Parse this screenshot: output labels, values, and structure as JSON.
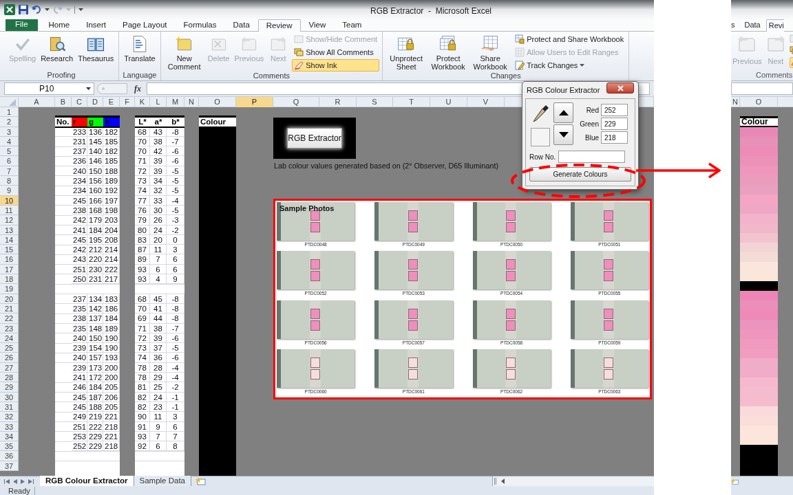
{
  "left_window": {
    "title": "RGB Extractor  -  Microsoft Excel",
    "tabs": [
      {
        "label": "File",
        "selected": false,
        "kind": "file"
      },
      {
        "label": "Home",
        "selected": false,
        "kind": "tab"
      },
      {
        "label": "Insert",
        "selected": false,
        "kind": "tab"
      },
      {
        "label": "Page Layout",
        "selected": false,
        "kind": "tab"
      },
      {
        "label": "Formulas",
        "selected": false,
        "kind": "tab"
      },
      {
        "label": "Data",
        "selected": false,
        "kind": "tab"
      },
      {
        "label": "Review",
        "selected": true,
        "kind": "tab"
      },
      {
        "label": "View",
        "selected": false,
        "kind": "tab"
      },
      {
        "label": "Team",
        "selected": false,
        "kind": "tab"
      }
    ],
    "ribbon_groups": [
      {
        "label": "Proofing",
        "buttons": [
          {
            "label": "Spelling",
            "disabled": true
          },
          {
            "label": "Research",
            "disabled": false
          },
          {
            "label": "Thesaurus",
            "disabled": false
          }
        ]
      },
      {
        "label": "Language",
        "buttons": [
          {
            "label": "Translate",
            "disabled": false
          }
        ]
      },
      {
        "label": "Comments",
        "buttons": [
          {
            "label": "New Comment",
            "disabled": false
          },
          {
            "label": "Delete",
            "disabled": true
          },
          {
            "label": "Previous",
            "disabled": true
          },
          {
            "label": "Next",
            "disabled": true
          }
        ],
        "small_buttons": [
          {
            "label": "Show/Hide Comment",
            "disabled": true,
            "on": false,
            "kind": "button"
          },
          {
            "label": "Show All Comments",
            "disabled": false,
            "on": false,
            "kind": "button"
          },
          {
            "label": "Show Ink",
            "disabled": false,
            "on": true,
            "kind": "button"
          }
        ]
      },
      {
        "label": "Changes",
        "buttons": [
          {
            "label": "Unprotect Sheet",
            "disabled": false
          },
          {
            "label": "Protect Workbook",
            "disabled": false
          },
          {
            "label": "Share Workbook",
            "disabled": false
          }
        ],
        "small_buttons": [
          {
            "label": "Protect and Share Workbook",
            "disabled": false,
            "on": false,
            "kind": "button"
          },
          {
            "label": "Allow Users to Edit Ranges",
            "disabled": true,
            "on": false,
            "kind": "button"
          },
          {
            "label": "Track Changes",
            "disabled": false,
            "on": false,
            "kind": "dropdown"
          }
        ]
      }
    ],
    "name_box": "P10",
    "function_label": "fx",
    "column_headers": [
      {
        "label": "A",
        "selected": false
      },
      {
        "label": "B",
        "selected": false
      },
      {
        "label": "C",
        "selected": false
      },
      {
        "label": "D",
        "selected": false
      },
      {
        "label": "E",
        "selected": false
      },
      {
        "label": "F",
        "selected": false
      },
      {
        "label": "K",
        "selected": false
      },
      {
        "label": "L",
        "selected": false
      },
      {
        "label": "M",
        "selected": false
      },
      {
        "label": "N",
        "selected": false
      },
      {
        "label": "O",
        "selected": false
      },
      {
        "label": "P",
        "selected": true
      },
      {
        "label": "Q",
        "selected": false
      },
      {
        "label": "R",
        "selected": false
      },
      {
        "label": "S",
        "selected": false
      },
      {
        "label": "T",
        "selected": false
      },
      {
        "label": "U",
        "selected": false
      },
      {
        "label": "V",
        "selected": false
      }
    ],
    "row_headers": [
      {
        "label": "1",
        "selected": false
      },
      {
        "label": "2",
        "selected": false
      },
      {
        "label": "3",
        "selected": false
      },
      {
        "label": "4",
        "selected": false
      },
      {
        "label": "5",
        "selected": false
      },
      {
        "label": "6",
        "selected": false
      },
      {
        "label": "7",
        "selected": false
      },
      {
        "label": "8",
        "selected": false
      },
      {
        "label": "9",
        "selected": false
      },
      {
        "label": "10",
        "selected": true
      },
      {
        "label": "11",
        "selected": false
      },
      {
        "label": "12",
        "selected": false
      },
      {
        "label": "13",
        "selected": false
      },
      {
        "label": "14",
        "selected": false
      },
      {
        "label": "15",
        "selected": false
      },
      {
        "label": "16",
        "selected": false
      },
      {
        "label": "17",
        "selected": false
      },
      {
        "label": "18",
        "selected": false
      },
      {
        "label": "19",
        "selected": false
      },
      {
        "label": "20",
        "selected": false
      },
      {
        "label": "21",
        "selected": false
      },
      {
        "label": "22",
        "selected": false
      },
      {
        "label": "23",
        "selected": false
      },
      {
        "label": "24",
        "selected": false
      },
      {
        "label": "25",
        "selected": false
      },
      {
        "label": "26",
        "selected": false
      },
      {
        "label": "27",
        "selected": false
      },
      {
        "label": "28",
        "selected": false
      },
      {
        "label": "29",
        "selected": false
      },
      {
        "label": "30",
        "selected": false
      },
      {
        "label": "31",
        "selected": false
      },
      {
        "label": "32",
        "selected": false
      },
      {
        "label": "33",
        "selected": false
      },
      {
        "label": "34",
        "selected": false
      },
      {
        "label": "35",
        "selected": false
      },
      {
        "label": "36",
        "selected": false
      },
      {
        "label": "37",
        "selected": false
      }
    ],
    "table": {
      "headers": [
        {
          "label": "No."
        },
        {
          "label": "r",
          "color": "#ff0000"
        },
        {
          "label": "g",
          "color": "#00ff00"
        },
        {
          "label": "b",
          "color": "#0000ff"
        },
        {
          "label": "L*"
        },
        {
          "label": "a*"
        },
        {
          "label": "b*"
        }
      ],
      "colour_header": "Colour",
      "groups": [
        {
          "rows": [
            [
              "233",
              "136",
              "182",
              "68",
              "43",
              "-8"
            ],
            [
              "231",
              "145",
              "185",
              "70",
              "38",
              "-7"
            ],
            [
              "237",
              "140",
              "182",
              "70",
              "42",
              "-6"
            ],
            [
              "236",
              "146",
              "185",
              "71",
              "39",
              "-6"
            ],
            [
              "240",
              "150",
              "188",
              "72",
              "39",
              "-5"
            ],
            [
              "234",
              "156",
              "189",
              "73",
              "34",
              "-5"
            ],
            [
              "234",
              "160",
              "192",
              "74",
              "32",
              "-5"
            ],
            [
              "245",
              "166",
              "197",
              "77",
              "33",
              "-4"
            ],
            [
              "238",
              "168",
              "198",
              "76",
              "30",
              "-5"
            ],
            [
              "242",
              "179",
              "203",
              "79",
              "26",
              "-3"
            ],
            [
              "241",
              "184",
              "204",
              "80",
              "24",
              "-2"
            ],
            [
              "245",
              "195",
              "208",
              "83",
              "20",
              "0"
            ],
            [
              "242",
              "212",
              "214",
              "87",
              "11",
              "3"
            ],
            [
              "243",
              "220",
              "214",
              "89",
              "7",
              "6"
            ],
            [
              "251",
              "230",
              "222",
              "93",
              "6",
              "6"
            ],
            [
              "250",
              "231",
              "217",
              "93",
              "4",
              "9"
            ]
          ]
        },
        {
          "rows": [
            [
              "237",
              "134",
              "183",
              "68",
              "45",
              "-8"
            ],
            [
              "235",
              "142",
              "186",
              "70",
              "41",
              "-8"
            ],
            [
              "238",
              "137",
              "184",
              "69",
              "44",
              "-8"
            ],
            [
              "235",
              "148",
              "189",
              "71",
              "38",
              "-7"
            ],
            [
              "240",
              "150",
              "190",
              "72",
              "39",
              "-6"
            ],
            [
              "239",
              "154",
              "190",
              "73",
              "37",
              "-5"
            ],
            [
              "240",
              "157",
              "193",
              "74",
              "36",
              "-6"
            ],
            [
              "239",
              "173",
              "200",
              "78",
              "28",
              "-4"
            ],
            [
              "241",
              "172",
              "200",
              "78",
              "29",
              "-4"
            ],
            [
              "246",
              "184",
              "205",
              "81",
              "25",
              "-2"
            ],
            [
              "245",
              "187",
              "206",
              "82",
              "24",
              "-1"
            ],
            [
              "245",
              "188",
              "205",
              "82",
              "23",
              "-1"
            ],
            [
              "249",
              "219",
              "221",
              "90",
              "11",
              "3"
            ],
            [
              "251",
              "222",
              "218",
              "91",
              "9",
              "6"
            ],
            [
              "253",
              "229",
              "221",
              "93",
              "7",
              "7"
            ],
            [
              "252",
              "229",
              "218",
              "92",
              "6",
              "8"
            ]
          ]
        }
      ]
    },
    "macro_button": "RGB Extractor",
    "note": "Lab colour values generated based on (2° Observer, D65 Illuminant)",
    "sample_photos": {
      "title": "Sample Photos",
      "captions": [
        "PTDC0048",
        "PTDC0049",
        "PTDC0050",
        "PTDC0051",
        "PTDC0052",
        "PTDC0053",
        "PTDC0054",
        "PTDC0055",
        "PTDC0056",
        "PTDC0057",
        "PTDC0058",
        "PTDC0059",
        "PTDC0060",
        "PTDC0061",
        "PTDC0062",
        "PTDC0063"
      ]
    },
    "dialog": {
      "title": "RGB Colour Extractor",
      "fields": [
        {
          "label": "Red",
          "value": "252"
        },
        {
          "label": "Green",
          "value": "229"
        },
        {
          "label": "Blue",
          "value": "218"
        }
      ],
      "row_label": "Row No.",
      "button": "Generate Colours"
    },
    "sheet_tabs": [
      {
        "label": "RGB Colour Extractor",
        "selected": true
      },
      {
        "label": "Sample Data",
        "selected": false
      }
    ],
    "status": "Ready"
  },
  "right_window": {
    "tabs": [
      {
        "label": "s",
        "selected": false
      },
      {
        "label": "Data",
        "selected": false
      },
      {
        "label": "Revi",
        "selected": true
      }
    ],
    "buttons": [
      {
        "label": "Previous",
        "disabled": true
      },
      {
        "label": "Next",
        "disabled": true
      }
    ],
    "group_label": "Comments",
    "column_headers": [
      {
        "label": "N"
      },
      {
        "label": "O"
      }
    ],
    "colour_column": {
      "header": "Colour",
      "groups": [
        {
          "swatches": [
            {
              "color": "#e988b6"
            },
            {
              "color": "#e791b9"
            },
            {
              "color": "#ed8cb6"
            },
            {
              "color": "#ec92b9"
            },
            {
              "color": "#f096bc"
            },
            {
              "color": "#ea9cbd"
            },
            {
              "color": "#eaa0c0"
            },
            {
              "color": "#f5a6c5"
            },
            {
              "color": "#eea8c6"
            },
            {
              "color": "#f2b3cb"
            },
            {
              "color": "#f1b8cc"
            },
            {
              "color": "#f5c3d0"
            },
            {
              "color": "#f2d4d6"
            },
            {
              "color": "#f3dcd6"
            },
            {
              "color": "#fbe6de"
            },
            {
              "color": "#fae7d9"
            }
          ]
        },
        {
          "swatches": [
            {
              "color": "#ed86b7"
            },
            {
              "color": "#eb8eba"
            },
            {
              "color": "#ee89b8"
            },
            {
              "color": "#eb94bd"
            },
            {
              "color": "#f096be"
            },
            {
              "color": "#ef9abe"
            },
            {
              "color": "#f09dc1"
            },
            {
              "color": "#efadc8"
            },
            {
              "color": "#f1acc8"
            },
            {
              "color": "#f6b8cd"
            },
            {
              "color": "#f5bbce"
            },
            {
              "color": "#f5bccd"
            },
            {
              "color": "#f9dbdd"
            },
            {
              "color": "#fbdeda"
            },
            {
              "color": "#fde5dd"
            },
            {
              "color": "#fce5da"
            }
          ]
        }
      ]
    }
  }
}
